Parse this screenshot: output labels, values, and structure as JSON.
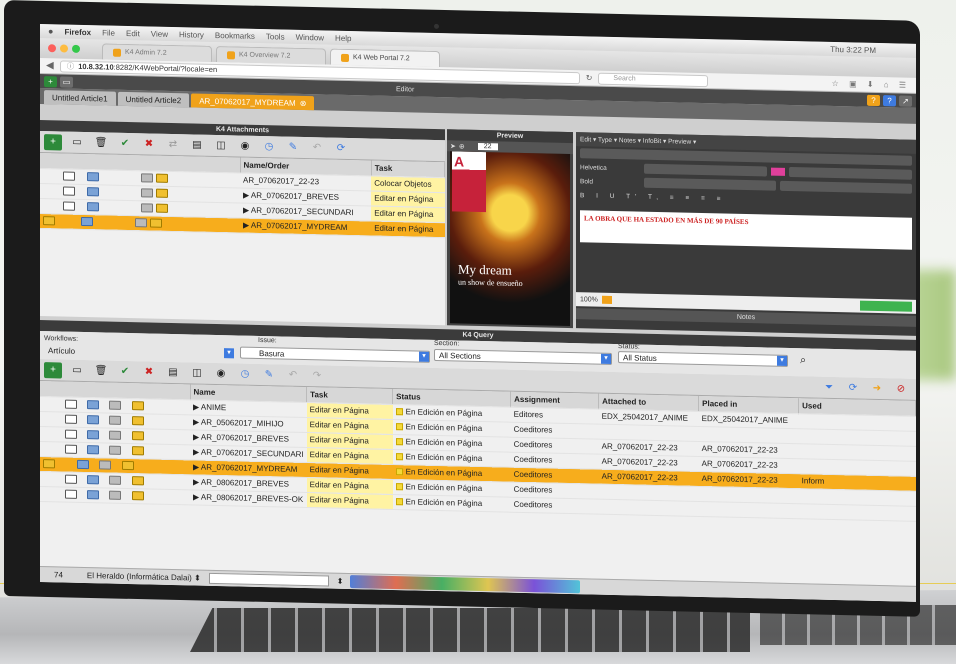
{
  "menubar": {
    "apple": "",
    "items": [
      "Firefox",
      "File",
      "Edit",
      "View",
      "History",
      "Bookmarks",
      "Tools",
      "Window",
      "Help"
    ],
    "clock": "Thu 3:22 PM"
  },
  "browser_tabs": [
    "K4 Admin 7.2",
    "K4 Overview 7.2",
    "K4 Web Portal 7.2"
  ],
  "url": {
    "host": "10.8.32.10",
    "rest": ":8282/K4WebPortal/?locale=en",
    "search_placeholder": "Search"
  },
  "app": {
    "editor_title": "Editor"
  },
  "doc_tabs": [
    "Untitled Article1",
    "Untitled Article2",
    "AR_07062017_MYDREAM"
  ],
  "attachments": {
    "title": "K4 Attachments",
    "col_name": "Name/Order",
    "col_task": "Task",
    "rows": [
      {
        "name": "AR_07062017_22-23",
        "task": "Colocar Objetos"
      },
      {
        "name": "▶ AR_07062017_BREVES",
        "task": "Editar en Página"
      },
      {
        "name": "▶ AR_07062017_SECUNDARI",
        "task": "Editar en Página"
      },
      {
        "name": "▶ AR_07062017_MYDREAM",
        "task": "Editar en Página"
      }
    ]
  },
  "preview": {
    "title": "Preview",
    "zoom": "22",
    "cover_text": "A",
    "headline": "My dream",
    "sub": "un show de ensueño"
  },
  "right_panel": {
    "menus": "Edit ▾   Type ▾   Notes ▾   InfoBit ▾   Preview ▾",
    "font": "Helvetica",
    "style": "Bold",
    "red_text": "LA OBRA QUE HA ESTADO EN MÁS DE 90 PAÍSES",
    "zoom": "100%",
    "notes": "Notes"
  },
  "query": {
    "title": "K4 Query",
    "workflows_label": "Workflows:",
    "workflows_value": "Artículo",
    "issue_label": "Issue:",
    "issue_value": "Basura",
    "section_label": "Section:",
    "section_value": "All Sections",
    "status_label": "Status:",
    "status_value": "All Status",
    "columns": [
      "Name",
      "Task",
      "Status",
      "Assignment",
      "Attached to",
      "Placed in",
      "Used"
    ],
    "rows": [
      {
        "name": "▶ ANIME",
        "task": "Editar en Página",
        "status": "En Edición en Página",
        "assign": "Editores",
        "attached": "EDX_25042017_ANIME",
        "placed": "EDX_25042017_ANIME",
        "used": "",
        "sel": false
      },
      {
        "name": "▶ AR_05062017_MIHIJO",
        "task": "Editar en Página",
        "status": "En Edición en Página",
        "assign": "Coeditores",
        "attached": "",
        "placed": "",
        "used": "",
        "sel": false
      },
      {
        "name": "▶ AR_07062017_BREVES",
        "task": "Editar en Página",
        "status": "En Edición en Página",
        "assign": "Coeditores",
        "attached": "AR_07062017_22-23",
        "placed": "AR_07062017_22-23",
        "used": "",
        "sel": false
      },
      {
        "name": "▶ AR_07062017_SECUNDARI",
        "task": "Editar en Página",
        "status": "En Edición en Página",
        "assign": "Coeditores",
        "attached": "AR_07062017_22-23",
        "placed": "AR_07062017_22-23",
        "used": "",
        "sel": false
      },
      {
        "name": "▶ AR_07062017_MYDREAM",
        "task": "Editar en Página",
        "status": "En Edición en Página",
        "assign": "Coeditores",
        "attached": "AR_07062017_22-23",
        "placed": "AR_07062017_22-23",
        "used": "Inform",
        "sel": true
      },
      {
        "name": "▶ AR_08062017_BREVES",
        "task": "Editar en Página",
        "status": "En Edición en Página",
        "assign": "Coeditores",
        "attached": "",
        "placed": "",
        "used": "",
        "sel": false
      },
      {
        "name": "▶ AR_08062017_BREVES-OK",
        "task": "Editar en Página",
        "status": "En Edición en Página",
        "assign": "Coeditores",
        "attached": "",
        "placed": "",
        "used": "",
        "sel": false
      }
    ],
    "count": "74",
    "publication": "El Heraldo (Informática Dalai)"
  }
}
